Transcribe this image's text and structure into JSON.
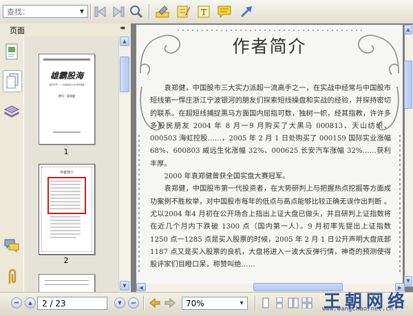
{
  "toolbar": {
    "search_placeholder": "查找：",
    "buttons": [
      "back-icon",
      "forward-icon",
      "zoom-search-icon",
      "highlight-icon",
      "note-pad-icon",
      "text-box-icon",
      "comment-icon",
      "arrow-tool-icon"
    ]
  },
  "sidebar": {
    "title": "页面",
    "collapse_symbol": "◂◂",
    "thumbnails": [
      {
        "label": "1",
        "cover_title": "雄霸股海",
        "cover_line1": "股市高手——“袁郑健实力派”操作秘技",
        "cover_author": "撰写：袁郑健"
      },
      {
        "label": "2",
        "inner_title": "作者简介"
      }
    ]
  },
  "document": {
    "title": "作者简介",
    "paragraphs": [
      "　　袁郑健，中国股市三大实力派超一流高手之一，在实战中经常与中国股市短线第一悍庄浙江宁波银河的朋友们探索短线操盘和实战的经验，并探持密切的联系。在超短线捕捉黑马方面国内屈指可数，独树一帜，经其指教，许许多多股民朋友 2004 年 8 月一9 月购买了大黑马 000813、天山纺织、000503 海虹控股……，2005 年 2 月 1 日处购买了 000159 国际实业涨幅 68%、600803 威远生化涨幅 32%、000625 长安汽车涨幅 32%……获利丰厚。",
      "　　2000 年袁郑健曾获全国实盘大赛冠军。",
      "　　袁郑健，中国股市第一代投资者，在大势研判上与把握热点挖掘等方面成功案例不胜枚举，对中国股市每年的低点与高点能够比较正确无误作出判断 。尤以2004 年4 月初在公开场合上指出上证大盘已做头，并且研判上证指数将在近几个月内下跌破 1300 点（国内第一人）。9 月初率先提出上证指数 1250 点一1285 点是买入股票的时候，2005 年 2 月 1 日公开声明大盘底部 1187 点又是买入股票的良机，大盘将进入一波大反弹行情，神奇的预测使得股评家们目瞪口呆，称赞叫绝……"
    ]
  },
  "statusbar": {
    "page_value": "2 / 23",
    "zoom_value": "70%",
    "nav": [
      "first-page-icon",
      "prev-page-icon",
      "next-page-icon",
      "last-page-icon",
      "go-back-icon",
      "go-forward-icon"
    ],
    "zoom_dropdown_symbol": "▾"
  },
  "watermark": {
    "text": "王朝网络",
    "url": "www.wangchao.net.cn"
  },
  "colors": {
    "chrome": "#ECE9D8",
    "doc_background": "#7E7E7E",
    "accent": "#2C4F8F"
  }
}
